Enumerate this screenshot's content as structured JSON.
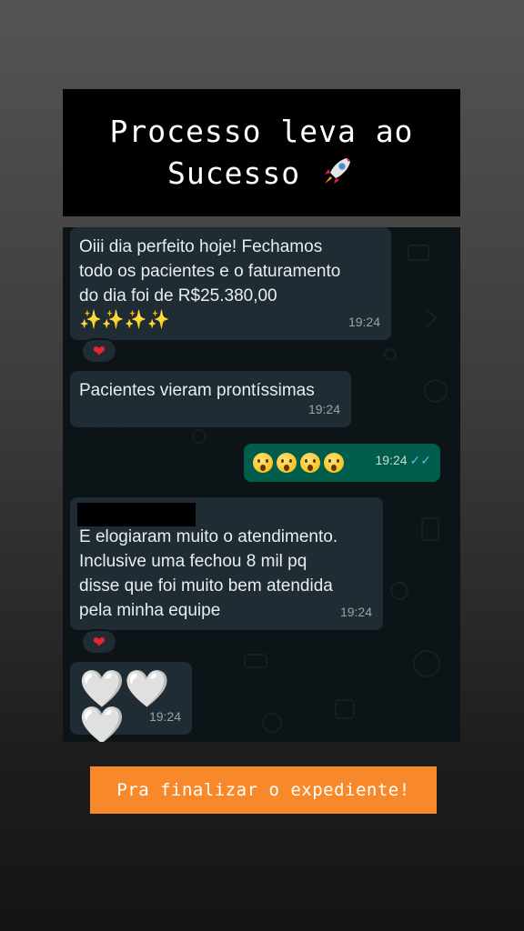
{
  "story": {
    "title_line1": "Processo leva ao",
    "title_line2": "Sucesso",
    "title_icon": "rocket-icon",
    "cta": "Pra finalizar o expediente!"
  },
  "chat": {
    "messages": [
      {
        "direction": "incoming",
        "lines": [
          "Oiii dia perfeito hoje! Fechamos",
          "todo os pacientes e o faturamento",
          "do dia foi de R$25.380,00"
        ],
        "emoji": "✨✨✨✨",
        "time": "19:24",
        "reaction": "❤"
      },
      {
        "direction": "incoming",
        "lines": [
          "Pacientes vieram prontíssimas"
        ],
        "time": "19:24"
      },
      {
        "direction": "outgoing",
        "emoji_icons": [
          "astonished-face-icon",
          "astonished-face-icon",
          "astonished-face-icon",
          "astonished-face-icon"
        ],
        "time": "19:24",
        "status": "read",
        "ticks": "✓✓"
      },
      {
        "direction": "incoming",
        "lines": [
          "E elogiaram muito o atendimento.",
          "Inclusive uma fechou 8 mil pq",
          "disse que foi muito bem atendida",
          "pela minha equipe"
        ],
        "time": "19:24",
        "reaction": "❤"
      },
      {
        "direction": "incoming",
        "emoji": "🤍🤍🤍",
        "time": "19:24"
      }
    ]
  },
  "colors": {
    "incoming_bubble": "#1f2c33",
    "outgoing_bubble": "#005c4b",
    "cta_background": "#f7892b",
    "read_ticks": "#53bdeb"
  }
}
